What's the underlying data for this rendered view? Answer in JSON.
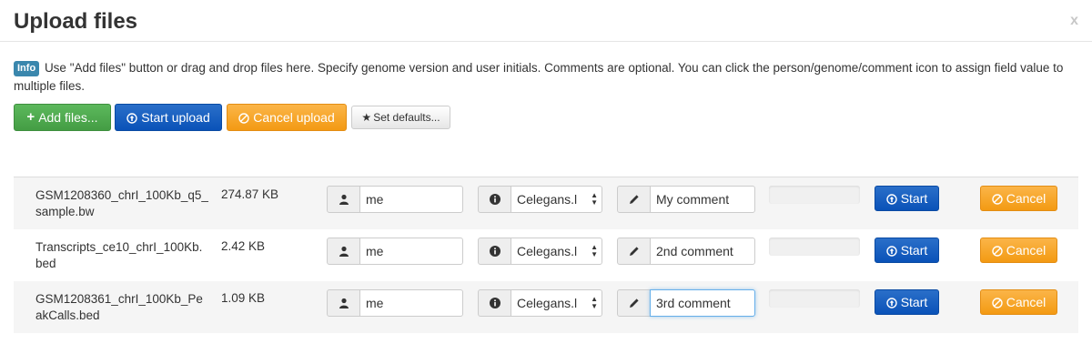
{
  "dialog": {
    "title": "Upload files",
    "close_label": "x"
  },
  "info": {
    "badge": "Info",
    "text": "Use \"Add files\" button or drag and drop files here. Specify genome version and user initials. Comments are optional. You can click the person/genome/comment icon to assign field value to multiple files."
  },
  "toolbar": {
    "add_files": "Add files...",
    "start_upload": "Start upload",
    "cancel_upload": "Cancel upload",
    "set_defaults": "Set defaults..."
  },
  "row_actions": {
    "start": "Start",
    "cancel": "Cancel"
  },
  "files": [
    {
      "name": "GSM1208360_chrI_100Kb_q5_sample.bw",
      "size": "274.87 KB",
      "user": "me",
      "genome": "Celegans.l",
      "comment": "My comment"
    },
    {
      "name": "Transcripts_ce10_chrI_100Kb.bed",
      "size": "2.42 KB",
      "user": "me",
      "genome": "Celegans.l",
      "comment": "2nd comment"
    },
    {
      "name": "GSM1208361_chrI_100Kb_PeakCalls.bed",
      "size": "1.09 KB",
      "user": "me",
      "genome": "Celegans.l",
      "comment": "3rd comment"
    }
  ],
  "colors": {
    "success": "#5cb85c",
    "primary": "#0a52b8",
    "warning": "#f39a13",
    "info_badge": "#3a87ad"
  }
}
